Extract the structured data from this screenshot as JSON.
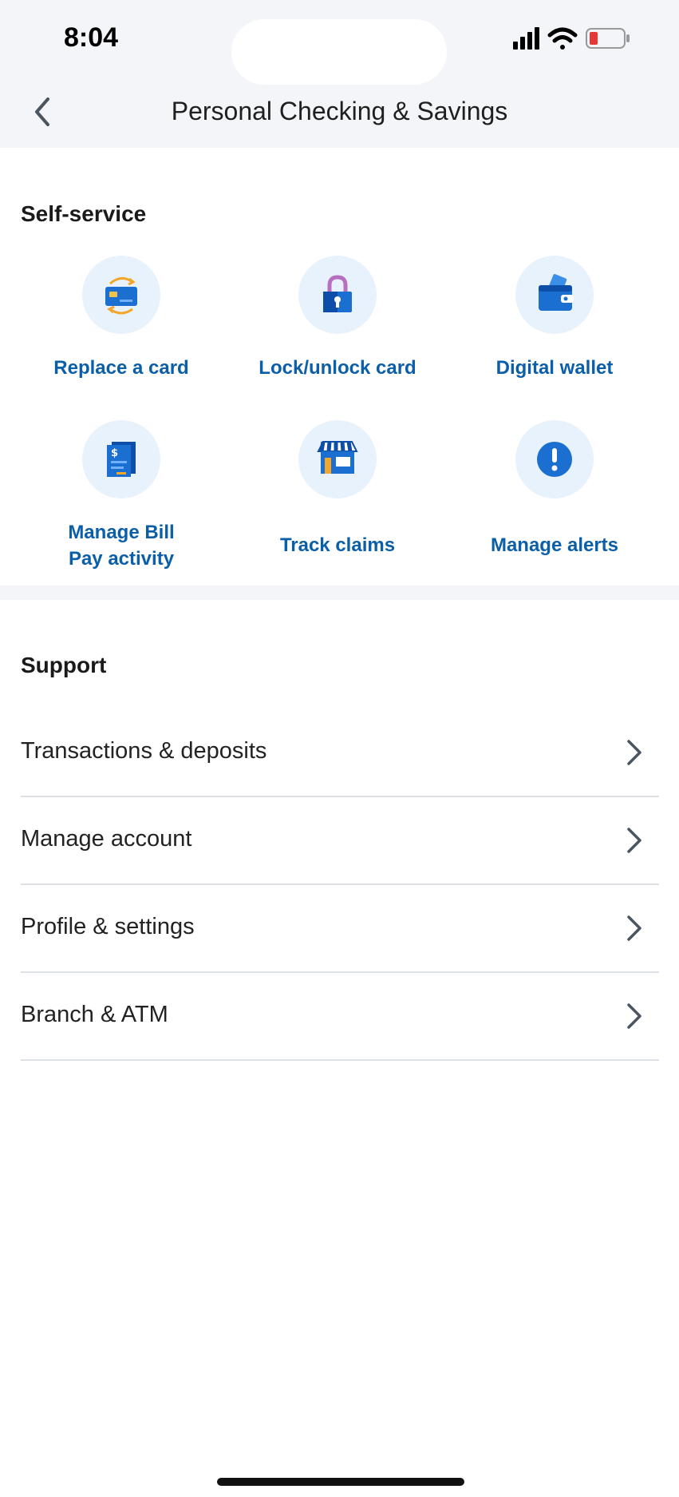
{
  "status": {
    "time": "8:04"
  },
  "header": {
    "title": "Personal Checking & Savings"
  },
  "self_service": {
    "title": "Self-service",
    "tiles": [
      {
        "label": "Replace a card",
        "icon": "replace-card-icon"
      },
      {
        "label": "Lock/unlock card",
        "icon": "lock-icon"
      },
      {
        "label": "Digital wallet",
        "icon": "wallet-icon"
      },
      {
        "label_line1": "Manage Bill",
        "label_line2": "Pay activity",
        "icon": "bill-icon"
      },
      {
        "label": "Track claims",
        "icon": "store-icon"
      },
      {
        "label": "Manage alerts",
        "icon": "alert-icon"
      }
    ]
  },
  "support": {
    "title": "Support",
    "items": [
      {
        "label": "Transactions & deposits"
      },
      {
        "label": "Manage account"
      },
      {
        "label": "Profile & settings"
      },
      {
        "label": "Branch & ATM"
      }
    ]
  },
  "colors": {
    "accent": "#0b5ea8",
    "header_bg": "#f3f5f8",
    "icon_circle": "#e8f2fc",
    "battery_low": "#e53935"
  }
}
